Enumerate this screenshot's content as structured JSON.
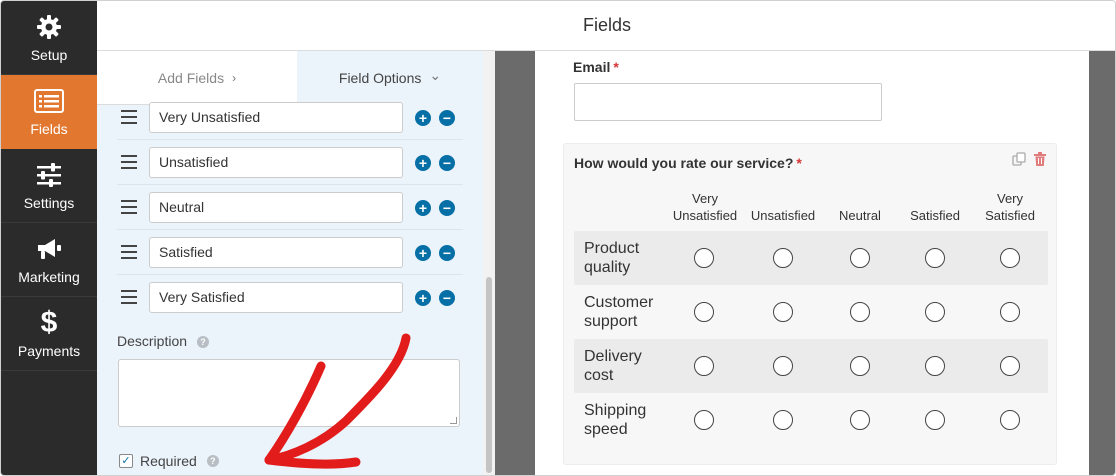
{
  "sidebar": {
    "items": [
      {
        "label": "Setup",
        "icon": "gear-icon",
        "active": false
      },
      {
        "label": "Fields",
        "icon": "list-icon",
        "active": true
      },
      {
        "label": "Settings",
        "icon": "sliders-icon",
        "active": false
      },
      {
        "label": "Marketing",
        "icon": "megaphone-icon",
        "active": false
      },
      {
        "label": "Payments",
        "icon": "dollar-icon",
        "active": false
      }
    ]
  },
  "header": {
    "title": "Fields"
  },
  "panel": {
    "tabs": {
      "add_fields": "Add Fields",
      "add_chevron": "›",
      "field_options": "Field Options",
      "options_chevron": "⌄"
    },
    "choices": [
      "Very Unsatisfied",
      "Unsatisfied",
      "Neutral",
      "Satisfied",
      "Very Satisfied"
    ],
    "choice_add": "+",
    "choice_remove": "−",
    "description_label": "Description",
    "help_glyph": "?",
    "required_label": "Required",
    "required_checked": true,
    "required_check_glyph": "✓"
  },
  "preview": {
    "email_label": "Email",
    "required_star": "*",
    "likert": {
      "question": "How would you rate our service?",
      "columns": [
        {
          "line1": "Very",
          "line2": "Unsatisfied"
        },
        {
          "line1": "",
          "line2": "Unsatisfied"
        },
        {
          "line1": "",
          "line2": "Neutral"
        },
        {
          "line1": "",
          "line2": "Satisfied"
        },
        {
          "line1": "Very",
          "line2": "Satisfied"
        }
      ],
      "rows": [
        {
          "line1": "Product",
          "line2": "quality"
        },
        {
          "line1": "Customer",
          "line2": "support"
        },
        {
          "line1": "Delivery",
          "line2": "cost"
        },
        {
          "line1": "Shipping",
          "line2": "speed"
        }
      ]
    }
  },
  "colors": {
    "sidebar_bg": "#2b2b2b",
    "accent": "#e27730",
    "panel_bg": "#ebf3fb",
    "button_blue": "#056fa6",
    "required_red": "#d63638",
    "annotation_red": "#e21b1b"
  }
}
